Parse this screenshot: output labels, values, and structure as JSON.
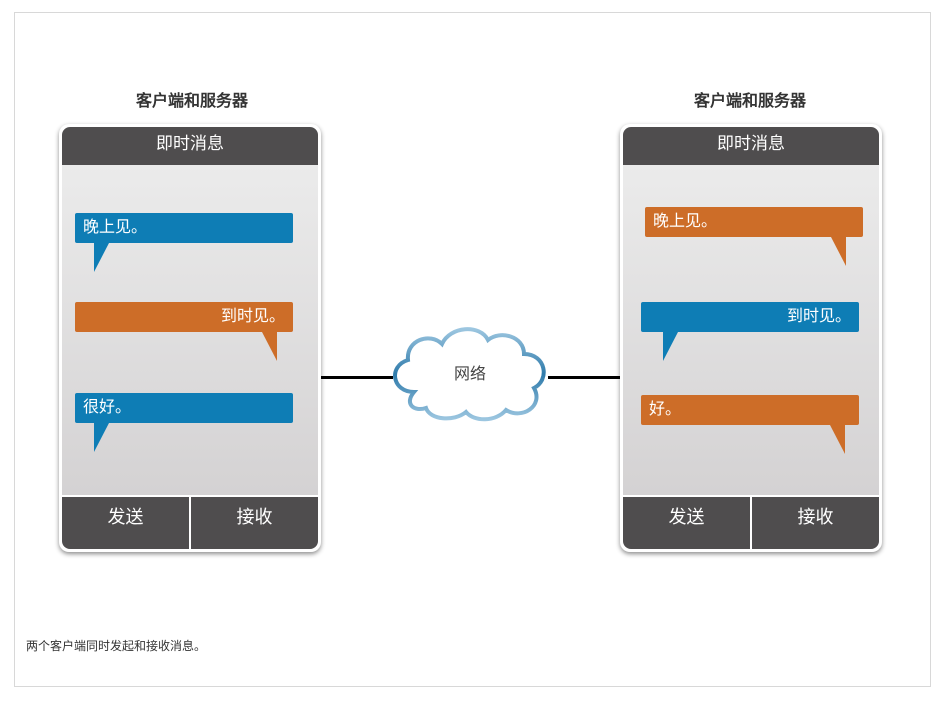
{
  "diagram": {
    "left_client": {
      "heading": "客户端和服务器",
      "app_title": "即时消息",
      "messages": [
        "晚上见。",
        "到时见。",
        "很好。"
      ],
      "send_label": "发送",
      "receive_label": "接收"
    },
    "right_client": {
      "heading": "客户端和服务器",
      "app_title": "即时消息",
      "messages": [
        "晚上见。",
        "到时见。",
        "好。"
      ],
      "send_label": "发送",
      "receive_label": "接收"
    },
    "network_label": "网络",
    "caption": "两个客户端同时发起和接收消息。"
  },
  "colors": {
    "blue_bubble": "#0e7db5",
    "orange_bubble": "#cd6d28",
    "phone_chrome": "#4f4d4e",
    "cloud_stroke": "#2f7bab"
  },
  "icons": [
    "cloud-icon"
  ]
}
